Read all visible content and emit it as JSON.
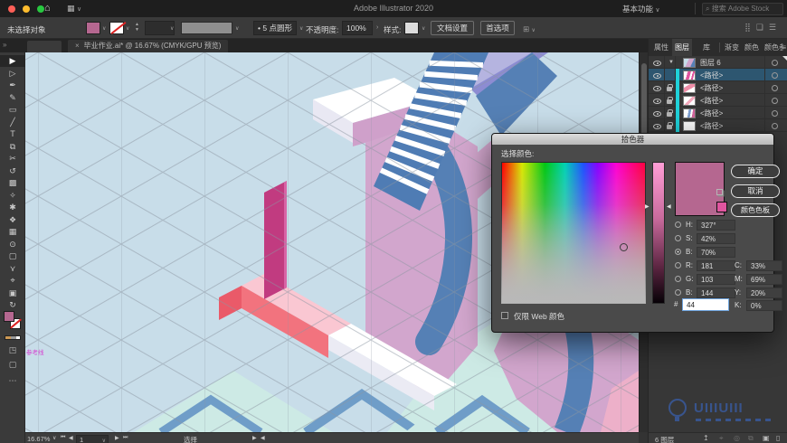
{
  "theme": {
    "accent_pink": "#B56790",
    "chip_pink": "#E0559F",
    "selected_row_blue": "#2D5670",
    "layer_cyan": "#1FD1D9",
    "canvas_bg": "#C8DDE9",
    "art_mauve": "#D2A6CD",
    "art_steel_blue": "#5580B5",
    "art_salmon": "#F2737E",
    "art_magenta": "#C13B80",
    "art_mint": "#CDEAE5",
    "art_lavender": "#B5B4E0"
  },
  "menubar": {
    "title": "Adobe Illustrator 2020",
    "workspace": "基本功能",
    "search_placeholder": "搜索 Adobe Stock"
  },
  "controlbar": {
    "selection_status": "未选择对象",
    "stroke_label": "描边:",
    "brush_bullet": "•",
    "brush_name": "5 点圆形",
    "opacity_label": "不透明度:",
    "opacity_value": "100%",
    "style_label": "样式:",
    "doc_setup_label": "文档设置",
    "preferences_label": "首选项"
  },
  "tabbar": {
    "close_glyph": "×",
    "doc_title": "毕业作业.ai* @ 16.67% (CMYK/GPU 预览)"
  },
  "toolbar": {
    "more_glyph": "⋯",
    "tools": [
      {
        "name": "selection-tool",
        "glyph": "▶"
      },
      {
        "name": "direct-selection-tool",
        "glyph": "▷"
      },
      {
        "name": "pen-tool",
        "glyph": "✒"
      },
      {
        "name": "curvature-tool",
        "glyph": "✎"
      },
      {
        "name": "rectangle-tool",
        "glyph": "▭"
      },
      {
        "name": "paintbrush-tool",
        "glyph": "╱"
      },
      {
        "name": "type-tool",
        "glyph": "T"
      },
      {
        "name": "free-transform-tool",
        "glyph": "⧉"
      },
      {
        "name": "scissors-tool",
        "glyph": "✂"
      },
      {
        "name": "rotate-tool",
        "glyph": "↺"
      },
      {
        "name": "gradient-tool",
        "glyph": "▩"
      },
      {
        "name": "eyedropper-tool",
        "glyph": "✧"
      },
      {
        "name": "blob-brush-tool",
        "glyph": "✱"
      },
      {
        "name": "symbol-sprayer-tool",
        "glyph": "❖"
      },
      {
        "name": "mesh-tool",
        "glyph": "▦"
      },
      {
        "name": "zoom-tool",
        "glyph": "⊙"
      },
      {
        "name": "artboard-tool",
        "glyph": "▢"
      },
      {
        "name": "join-tool",
        "glyph": "⋎"
      },
      {
        "name": "measure-tool",
        "glyph": "⌖"
      },
      {
        "name": "graph-tool",
        "glyph": "▣"
      },
      {
        "name": "rotate-view-tool",
        "glyph": "↻"
      }
    ]
  },
  "canvas": {
    "guide_label": "参考线"
  },
  "picker": {
    "title": "拾色器",
    "select_label": "选择颜色:",
    "ok_label": "确定",
    "cancel_label": "取消",
    "swatches_label": "颜色色板",
    "web_only_label": "仅限 Web 颜色",
    "color": "#B56790",
    "chip_color": "#E0559F",
    "fields": {
      "h": {
        "label": "H:",
        "value": "327°"
      },
      "s": {
        "label": "S:",
        "value": "42%"
      },
      "b": {
        "label": "B:",
        "value": "70%"
      },
      "r": {
        "label": "R:",
        "value": "181"
      },
      "g": {
        "label": "G:",
        "value": "103"
      },
      "b2": {
        "label": "B:",
        "value": "144"
      },
      "hex": {
        "label": "#",
        "value": "44"
      },
      "c": {
        "label": "C:",
        "value": "33%"
      },
      "m": {
        "label": "M:",
        "value": "69%"
      },
      "y": {
        "label": "Y:",
        "value": "20%"
      },
      "k": {
        "label": "K:",
        "value": "0%"
      }
    }
  },
  "panel": {
    "tabs": [
      "属性",
      "图层",
      "库",
      "渐变",
      "颜色",
      "颜色参"
    ],
    "menu_glyph": "≡",
    "layers": [
      {
        "label": "图层 6"
      },
      {
        "label": "<路径>"
      },
      {
        "label": "<路径>"
      },
      {
        "label": "<路径>"
      },
      {
        "label": "<路径>"
      },
      {
        "label": "<路径>"
      }
    ],
    "footer_count": "6 图层"
  },
  "statusbar": {
    "zoom": "16.67%",
    "artboard_value": "1",
    "tool_name": "选择"
  },
  "watermark": {
    "text": "UIIIUIII"
  }
}
